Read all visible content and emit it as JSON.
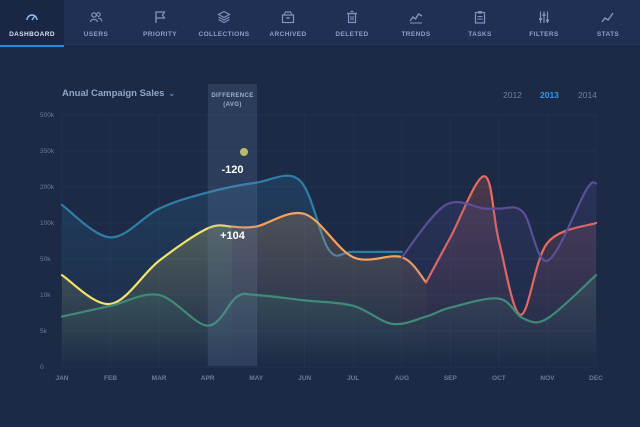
{
  "nav": {
    "items": [
      {
        "label": "DASHBOARD",
        "icon": "gauge-icon",
        "active": true
      },
      {
        "label": "USERS",
        "icon": "users-icon",
        "active": false
      },
      {
        "label": "PRIORITY",
        "icon": "flag-icon",
        "active": false
      },
      {
        "label": "COLLECTIONS",
        "icon": "layers-icon",
        "active": false
      },
      {
        "label": "ARCHIVED",
        "icon": "archive-icon",
        "active": false
      },
      {
        "label": "DELETED",
        "icon": "trash-icon",
        "active": false
      },
      {
        "label": "TRENDS",
        "icon": "trend-icon",
        "active": false
      },
      {
        "label": "TASKS",
        "icon": "clipboard-icon",
        "active": false
      },
      {
        "label": "FILTERS",
        "icon": "sliders-icon",
        "active": false
      },
      {
        "label": "STATS",
        "icon": "chart-icon",
        "active": false
      }
    ]
  },
  "header": {
    "title": "Anual Campaign Sales",
    "years": [
      "2012",
      "2013",
      "2014"
    ],
    "selected_year": "2013"
  },
  "difference": {
    "title_line1": "DIFFERENCE",
    "title_line2": "(AVG)",
    "value_top": "-120",
    "value_bottom": "+104"
  },
  "colors": {
    "background": "#1c2a46",
    "accent": "#2f97f0",
    "series_teal": "#2f7ea8",
    "series_yellow": "#f2e26a",
    "series_orange": "#f6a25a",
    "series_red": "#ee6b5e",
    "series_purple": "#5b4f98",
    "series_green": "#3f8a78",
    "marker": "#c8c45a"
  },
  "chart_data": {
    "type": "line",
    "categories": [
      "JAN",
      "FEB",
      "MAR",
      "APR",
      "MAY",
      "JUN",
      "JUL",
      "AUG",
      "SEP",
      "OCT",
      "NOV",
      "DEC"
    ],
    "y_ticks": [
      "0",
      "5k",
      "10k",
      "50k",
      "100k",
      "200k",
      "350k",
      "500k"
    ],
    "ylim": [
      0,
      7
    ],
    "series": [
      {
        "color_key": "series_teal",
        "x": [
          0,
          1,
          2,
          3,
          4,
          4.9,
          5.5,
          6,
          7
        ],
        "values": [
          4.5,
          3.6,
          4.4,
          4.85,
          5.12,
          5.18,
          3.25,
          3.2,
          3.2
        ]
      },
      {
        "color_key": "series_yellow",
        "x": [
          0,
          1,
          2,
          3,
          3.5
        ],
        "values": [
          2.55,
          1.75,
          2.95,
          3.85,
          3.9
        ]
      },
      {
        "color_key": "series_orange",
        "x": [
          3.5,
          4,
          5,
          6,
          7,
          7.5
        ],
        "values": [
          3.9,
          3.9,
          4.25,
          3.05,
          3.05,
          2.35
        ]
      },
      {
        "color_key": "series_red",
        "x": [
          7.5,
          8,
          8.7,
          9,
          9.45,
          10,
          11
        ],
        "values": [
          2.35,
          3.6,
          5.3,
          3.5,
          1.45,
          3.45,
          4.0
        ]
      },
      {
        "color_key": "series_purple",
        "x": [
          7,
          7.9,
          8.7,
          9,
          9.5,
          10,
          10.8,
          11
        ],
        "values": [
          3.05,
          4.5,
          4.4,
          4.4,
          4.3,
          2.95,
          4.92,
          5.1
        ]
      },
      {
        "color_key": "series_green",
        "x": [
          0,
          1,
          2,
          3,
          3.6,
          4,
          5,
          6,
          6.8,
          7.5,
          8,
          9,
          9.5,
          10,
          11
        ],
        "values": [
          1.4,
          1.7,
          2.0,
          1.15,
          1.95,
          2.0,
          1.85,
          1.7,
          1.2,
          1.4,
          1.65,
          1.9,
          1.35,
          1.35,
          2.55
        ]
      }
    ]
  }
}
